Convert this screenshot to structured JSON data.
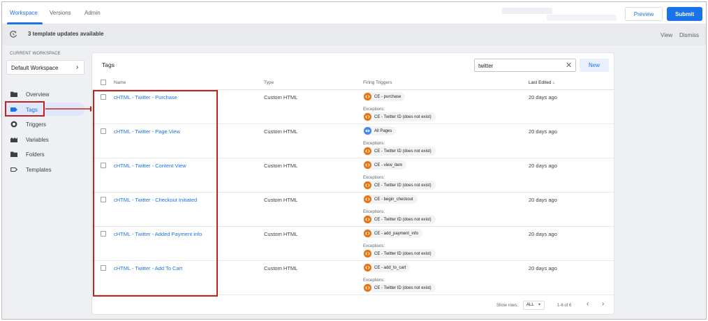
{
  "topbar": {
    "tabs": [
      "Workspace",
      "Versions",
      "Admin"
    ],
    "preview_label": "Preview",
    "submit_label": "Submit"
  },
  "banner": {
    "text": "3 template updates available",
    "view_label": "View",
    "dismiss_label": "Dismiss"
  },
  "sidebar": {
    "workspace_label": "CURRENT WORKSPACE",
    "workspace_value": "Default Workspace",
    "items": [
      {
        "label": "Overview",
        "icon": "folder-icon"
      },
      {
        "label": "Tags",
        "icon": "tag-icon"
      },
      {
        "label": "Triggers",
        "icon": "trigger-icon"
      },
      {
        "label": "Variables",
        "icon": "variables-icon"
      },
      {
        "label": "Folders",
        "icon": "folder-icon"
      },
      {
        "label": "Templates",
        "icon": "template-icon"
      }
    ],
    "active_item": "Tags"
  },
  "main": {
    "title": "Tags",
    "search_value": "twitter",
    "new_label": "New",
    "columns": [
      "Name",
      "Type",
      "Firing Triggers",
      "Last Edited"
    ],
    "exceptions_label": "Exceptions:",
    "rows": [
      {
        "name": "cHTML - Twitter - Purchase",
        "type": "Custom HTML",
        "trigger": "CE - purchase",
        "exception": "CE - Twitter ID (does not exist)",
        "edited": "20 days ago"
      },
      {
        "name": "cHTML - Twitter - Page View",
        "type": "Custom HTML",
        "trigger": "All Pages",
        "exception": "CE - Twitter ID (does not exist)",
        "edited": "20 days ago"
      },
      {
        "name": "cHTML - Twitter - Content View",
        "type": "Custom HTML",
        "trigger": "CE - view_item",
        "exception": "CE - Twitter ID (does not exist)",
        "edited": "20 days ago"
      },
      {
        "name": "cHTML - Twitter - Checkout Initiated",
        "type": "Custom HTML",
        "trigger": "CE - begin_checkout",
        "exception": "CE - Twitter ID (does not exist)",
        "edited": "20 days ago"
      },
      {
        "name": "cHTML - Twitter - Added Payment info",
        "type": "Custom HTML",
        "trigger": "CE - add_payment_info",
        "exception": "CE - Twitter ID (does not exist)",
        "edited": "20 days ago"
      },
      {
        "name": "cHTML - Twitter - Add To Cart",
        "type": "Custom HTML",
        "trigger": "CE - add_to_cart",
        "exception": "CE - Twitter ID (does not exist)",
        "edited": "20 days ago"
      }
    ],
    "footer": {
      "show_rows_label": "Show rows:",
      "show_rows_value": "ALL",
      "count": "1-6 of 6"
    }
  },
  "colors": {
    "accent": "#1a73e8",
    "highlight": "#c5221f",
    "trigger_custom": "#e8710a",
    "trigger_page": "#4285f4"
  }
}
